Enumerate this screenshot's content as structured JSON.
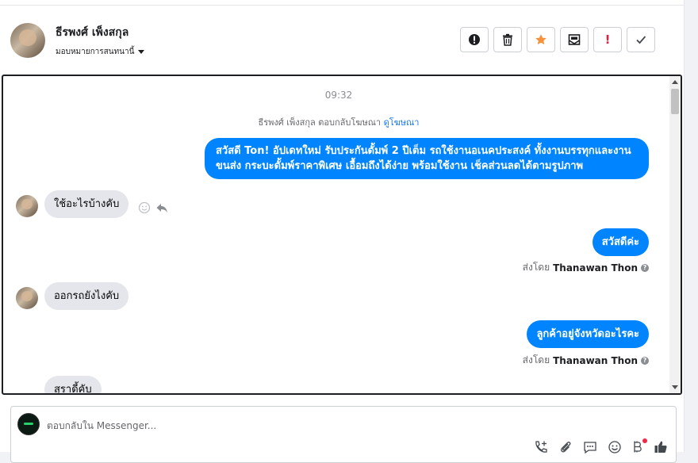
{
  "header": {
    "contact_name": "ธีรพงศ์ เพ็งสกุล",
    "assign_label": "มอบหมายการสนทนานี้",
    "toolbar": [
      {
        "name": "spam-button",
        "icon": "!"
      },
      {
        "name": "delete-button",
        "icon": "🗑"
      },
      {
        "name": "star-button",
        "icon": "★"
      },
      {
        "name": "mark-unread-button",
        "icon": "✉"
      },
      {
        "name": "urgent-button",
        "icon": "!"
      },
      {
        "name": "done-button",
        "icon": "✓"
      }
    ]
  },
  "chat": {
    "timestamp": "09:32",
    "ad_reply_prefix": "ธีรพงศ์ เพ็งสกุล ตอบกลับโฆษณา",
    "ad_reply_link": "ดูโฆษณา",
    "messages": [
      {
        "text": "สวัสดี Ton! อัปเดทใหม่ รับประกันดั้มพ์ 2 ปีเต็ม รถใช้งานอเนคประสงค์ ทั้งงานบรรทุกและงานขนส่ง กระบะดั้มพ์ราคาพิเศษ เอื้อมถึงได้ง่าย พร้อมใช้งาน เช็คส่วนลดได้ตามรูปภาพ"
      },
      {
        "text": "ใช้อะไรบ้างคับ"
      },
      {
        "text": "สวัสดีค่ะ"
      },
      {
        "text": "ออกรถยังไงคับ"
      },
      {
        "text": "ลูกค้าอยู่จังหวัดอะไรคะ"
      },
      {
        "text": "สุราดี้คับ"
      }
    ],
    "sent_by_prefix": "ส่งโดย",
    "sent_by_name": "Thanawan Thon"
  },
  "composer": {
    "placeholder": "ตอบกลับใน Messenger..."
  }
}
